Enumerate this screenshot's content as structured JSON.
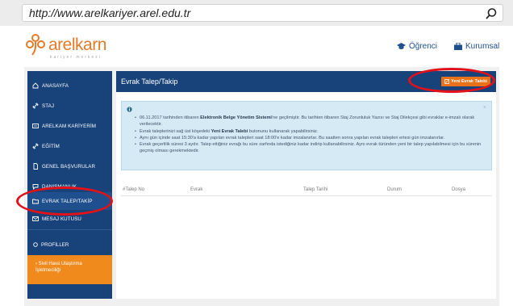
{
  "browser": {
    "url": "http://www.arelkariyer.arel.edu.tr",
    "search_icon": "search-icon"
  },
  "header": {
    "logo_text": "arelkarn",
    "logo_subtext": "kariyer merkezi",
    "links": [
      {
        "label": "Öğrenci",
        "icon": "graduation-cap-icon"
      },
      {
        "label": "Kurumsal",
        "icon": "briefcase-icon"
      }
    ]
  },
  "sidebar": {
    "items": [
      {
        "label": "ANASAYFA",
        "icon": "home-icon"
      },
      {
        "label": "STAJ",
        "icon": "link-icon"
      },
      {
        "label": "ARELKAM KARİYERİM",
        "icon": "card-icon"
      },
      {
        "label": "EĞİTİM",
        "icon": "link-icon"
      },
      {
        "label": "GENEL BAŞVURULAR",
        "icon": "document-icon"
      },
      {
        "label": "DANIŞMANLIK",
        "icon": "chat-icon"
      },
      {
        "label": "EVRAK TALEP/TAKİP",
        "icon": "folder-icon"
      },
      {
        "label": "MESAJ KUTUSU",
        "icon": "mail-icon"
      }
    ],
    "profiles_label": "PROFİLLER",
    "profile_item": "Sivil Hava Ulaştırma İşletmeciliği"
  },
  "content": {
    "title": "Evrak Talep/Takip",
    "new_button": "Yeni Evrak Talebi",
    "info": [
      {
        "pre": "06.11.2017 tarihinden itibaren ",
        "bold": "Elektronik Belge Yönetim Sistemi",
        "post": "'ne geçilmiştir. Bu tarihten itibaren Staj Zorunluluk Yazısı ve Staj Dilekçesi gibi evraklar e-imzalı olarak verilecektir."
      },
      {
        "pre": "Evrak taleplerinizi sağ üst köşedeki ",
        "bold": "Yeni Evrak Talebi",
        "post": " butonunu kullanarak yapabilirsiniz."
      },
      {
        "pre": "Aynı gün içinde saat 15:30'a kadar yapılan evrak talepleri saat 18:00'e kadar imzalanırlar. Bu saatten sonra yapılan evrak talepleri ertesi gün imzalanırlar.",
        "bold": "",
        "post": ""
      },
      {
        "pre": "Evrak geçerlilik süresi 3 aydır. Talep ettiğiniz evrağı bu süre zarfında istediğiniz kadar indirip kullanabilirsiniz. Aynı evrak türünden yeni bir talep yapılabilmesi için bu sürenin geçmiş olması gerekmektedir.",
        "bold": "",
        "post": ""
      }
    ],
    "table_headers": [
      "#Talep No",
      "Evrak",
      "Talep Tarihi",
      "Durum",
      "Dosya"
    ]
  },
  "colors": {
    "navy": "#17427a",
    "orange": "#e8711a",
    "highlight": "#e1121a"
  }
}
